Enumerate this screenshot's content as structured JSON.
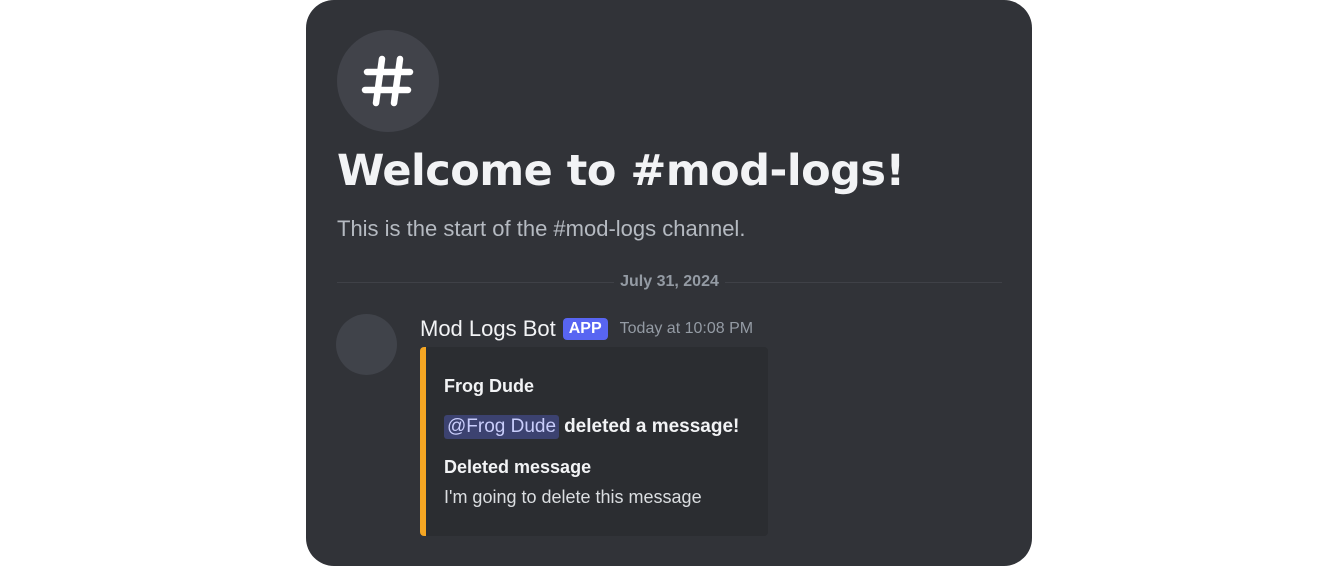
{
  "channel": {
    "icon": "hashtag-icon",
    "welcome_title": "Welcome to #mod-logs!",
    "subtitle": "This is the start of the #mod-logs channel."
  },
  "divider": {
    "date": "July 31, 2024"
  },
  "message": {
    "author": "Mod Logs Bot",
    "badge": "APP",
    "timestamp": "Today at 10:08 PM",
    "embed": {
      "accent_color": "#f5a623",
      "author": "Frog Dude",
      "mention": "@Frog Dude",
      "action": "deleted a message!",
      "field_name": "Deleted message",
      "field_value": "I'm going to delete this message"
    }
  },
  "colors": {
    "background": "#313338",
    "badge": "#5865f2",
    "embed_background": "#2b2d31"
  }
}
